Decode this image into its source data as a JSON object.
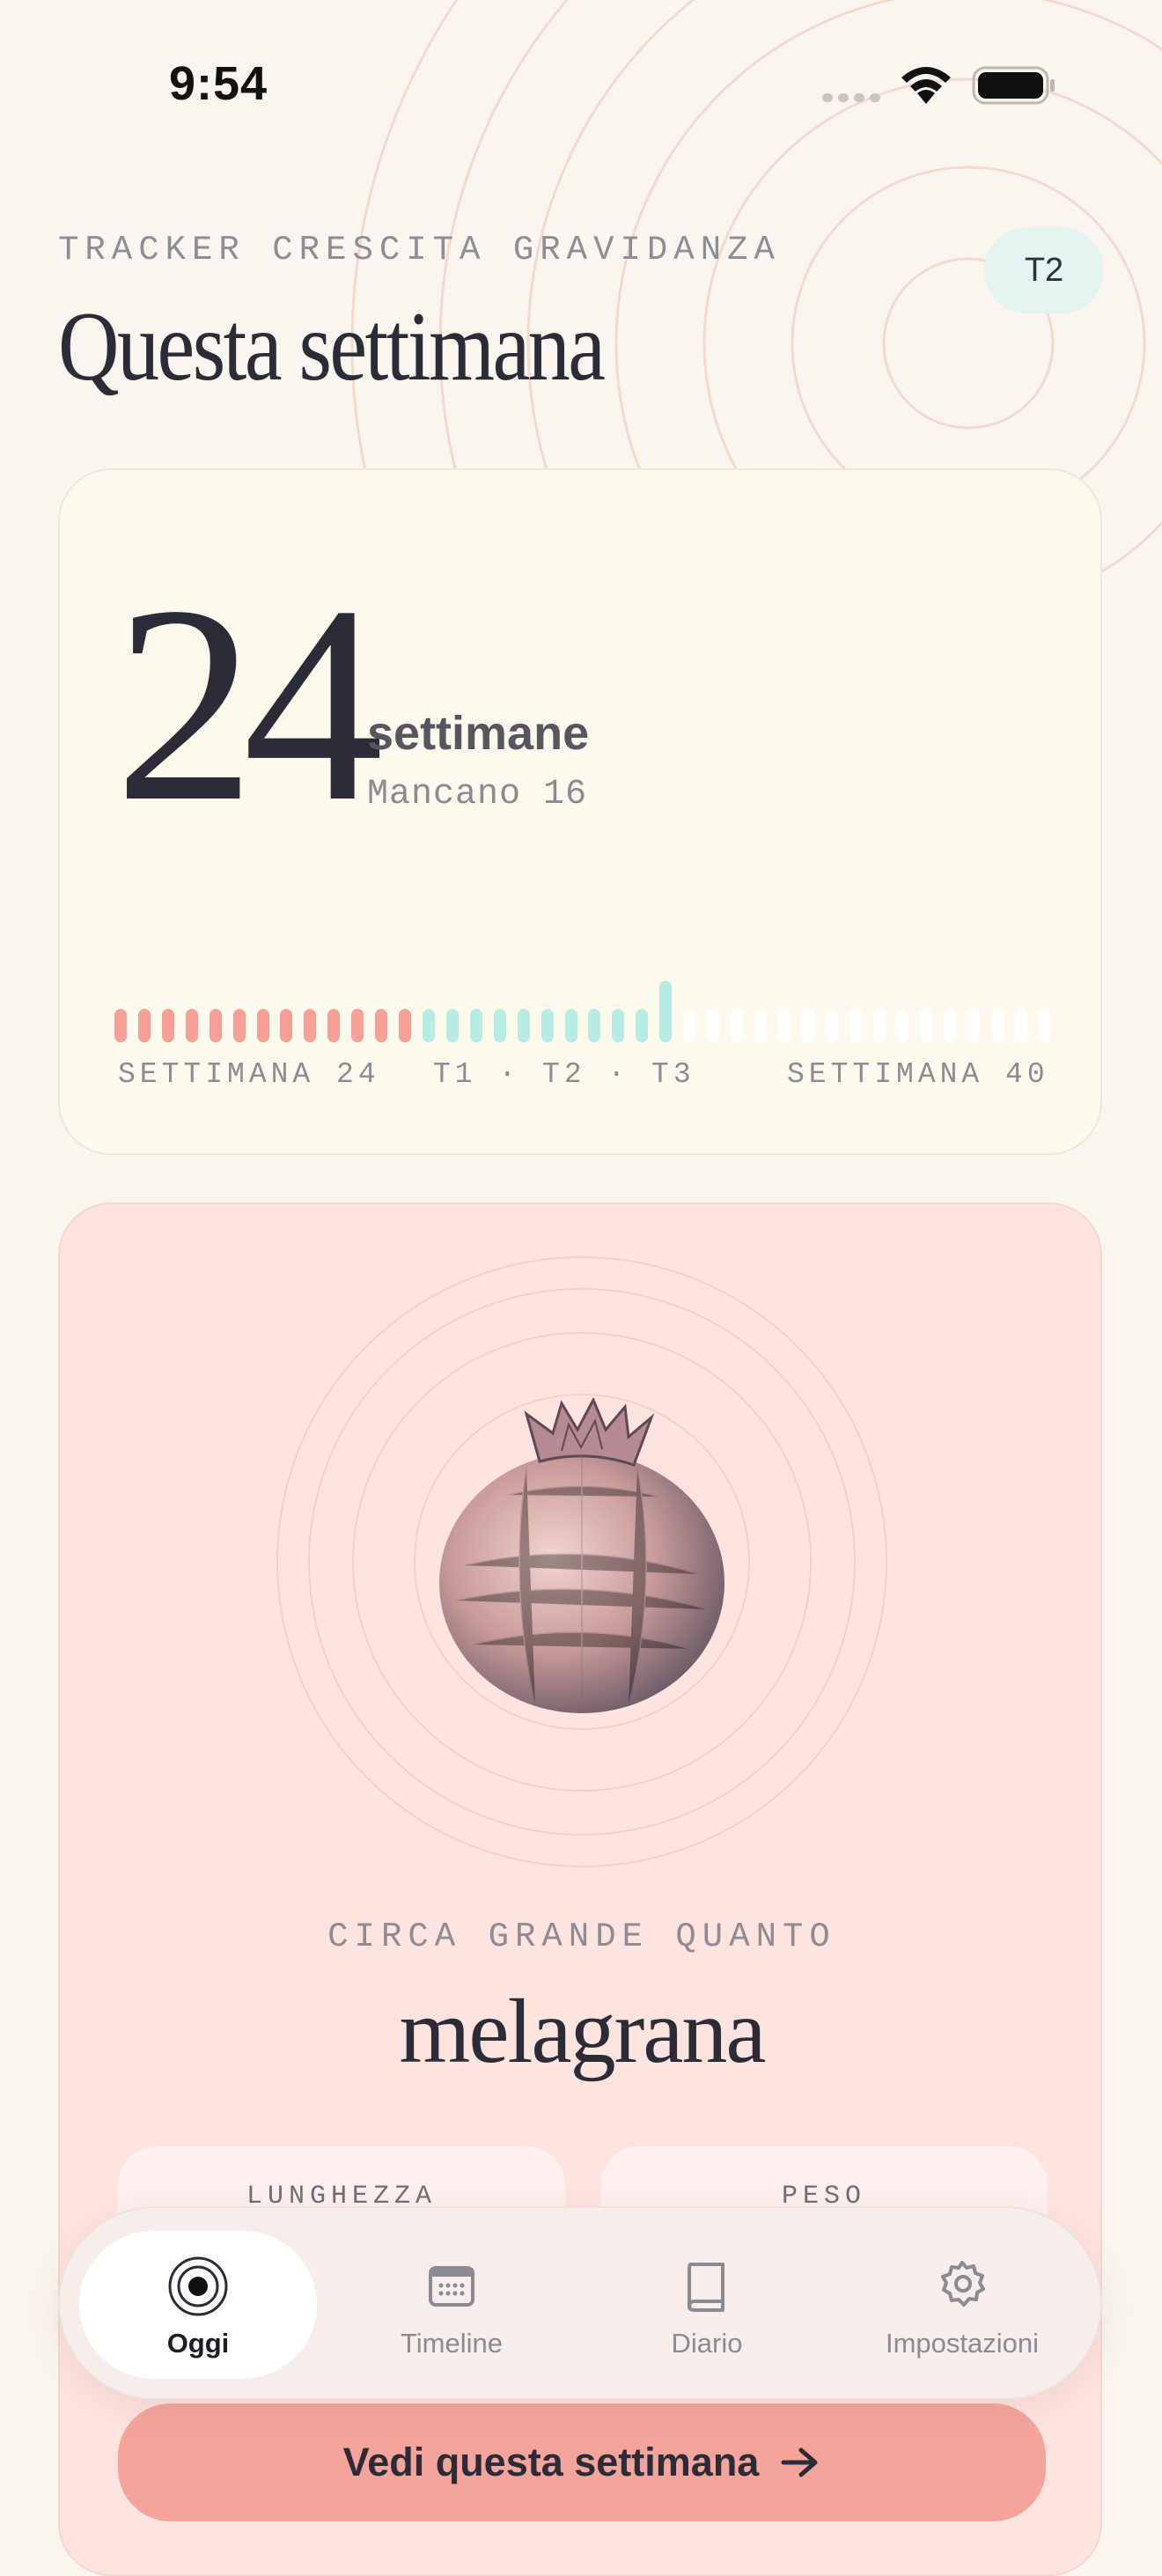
{
  "status_bar": {
    "time": "9:54"
  },
  "header": {
    "eyebrow": "TRACKER CRESCITA GRAVIDANZA",
    "title": "Questa settimana",
    "trimester_badge": "T2"
  },
  "week_card": {
    "week_number": "24",
    "unit": "settimane",
    "remaining": "Mancano 16",
    "progress": {
      "current_week": 24,
      "total_weeks": 40,
      "t1_end_week": 13,
      "t2_end_week": 27
    },
    "scale": {
      "start": "SETTIMANA 24",
      "trimesters": "T1 · T2 · T3",
      "end": "SETTIMANA 40"
    },
    "colors": {
      "t1": "#f6a097",
      "t2": "#b6ece2",
      "t3": "#ffffff"
    }
  },
  "fruit_card": {
    "fruit_icon": "pomegranate-illustration",
    "eyebrow": "CIRCA GRANDE QUANTO",
    "name": "melagrana",
    "stats": [
      {
        "label": "LUNGHEZZA"
      },
      {
        "label": "PESO"
      }
    ],
    "cta_label": "Vedi questa settimana",
    "cta_icon": "arrow-right-icon"
  },
  "tabbar": {
    "items": [
      {
        "label": "Oggi",
        "icon": "target-icon",
        "active": true
      },
      {
        "label": "Timeline",
        "icon": "calendar-icon",
        "active": false
      },
      {
        "label": "Diario",
        "icon": "book-icon",
        "active": false
      },
      {
        "label": "Impostazioni",
        "icon": "gear-icon",
        "active": false
      }
    ]
  }
}
